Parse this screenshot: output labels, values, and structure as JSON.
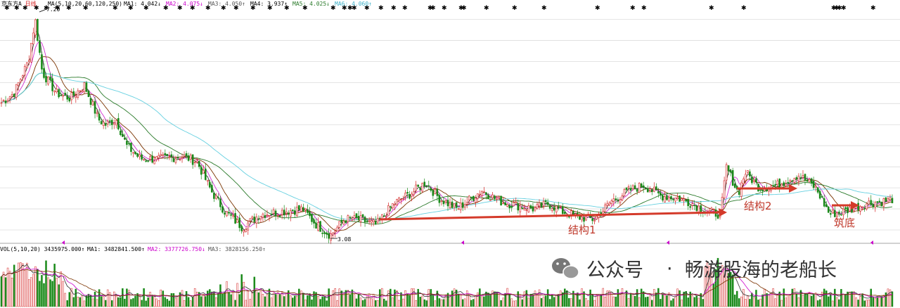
{
  "header": {
    "stock_name": "京东方A",
    "period": "日线",
    "ma_params": "MA(5,10,20,60,120,250)",
    "ma1": "MA1: 4.042↓",
    "ma2": "MA2: 4.075↓",
    "ma3": "MA3: 4.050↑",
    "ma4": "MA4: 3.937↑",
    "ma5": "MA5: 4.025↓",
    "ma6": "MA6: 4.060↑"
  },
  "volume_header": {
    "params": "VOL(5,10,20) 3435975.000↑",
    "ma1": "MA1: 3482841.500↑",
    "ma2": "MA2: 3377726.750↓",
    "ma3": "MA3: 3828156.250↑"
  },
  "price_labels": {
    "high": "7.20",
    "low": "3.08"
  },
  "annotations": {
    "structure1": "结构1",
    "structure2": "结构2",
    "bottom": "筑底"
  },
  "watermark": {
    "dot": "·",
    "text1": "公众号",
    "text2": "畅游股海的老船长"
  },
  "colors": {
    "up": "#d42020",
    "down": "#1a8a1a",
    "arrow": "#d43a2a",
    "ma5": "#333333",
    "ma10": "#d030d0",
    "ma20": "#7a3300",
    "ma60": "#2a7a2a",
    "ma120": "#66d0e0",
    "marker": "#cc00cc"
  },
  "chart_data": {
    "type": "candlestick",
    "panels": [
      "price",
      "volume"
    ],
    "ylim": [
      3.0,
      7.3
    ],
    "grid": true,
    "y_gridlines": [
      3.2,
      3.6,
      4.0,
      4.4,
      4.8,
      5.2,
      5.6,
      6.0,
      6.4,
      6.8,
      7.2
    ],
    "x_points": 420,
    "price_path": [
      [
        0,
        5.6
      ],
      [
        20,
        5.8
      ],
      [
        40,
        6.4
      ],
      [
        50,
        7.2
      ],
      [
        60,
        6.2
      ],
      [
        80,
        5.8
      ],
      [
        100,
        5.7
      ],
      [
        120,
        5.95
      ],
      [
        140,
        5.3
      ],
      [
        150,
        5.2
      ],
      [
        165,
        5.3
      ],
      [
        180,
        4.8
      ],
      [
        200,
        4.55
      ],
      [
        230,
        4.55
      ],
      [
        260,
        4.6
      ],
      [
        280,
        4.5
      ],
      [
        300,
        3.95
      ],
      [
        320,
        3.55
      ],
      [
        345,
        3.25
      ],
      [
        370,
        3.5
      ],
      [
        400,
        3.55
      ],
      [
        430,
        3.6
      ],
      [
        450,
        3.3
      ],
      [
        470,
        3.1
      ],
      [
        490,
        3.4
      ],
      [
        510,
        3.4
      ],
      [
        535,
        3.3
      ],
      [
        560,
        3.7
      ],
      [
        585,
        3.9
      ],
      [
        605,
        4.1
      ],
      [
        625,
        3.8
      ],
      [
        650,
        3.6
      ],
      [
        685,
        3.95
      ],
      [
        710,
        3.75
      ],
      [
        740,
        3.65
      ],
      [
        760,
        3.6
      ],
      [
        780,
        3.7
      ],
      [
        800,
        3.55
      ],
      [
        820,
        3.45
      ],
      [
        845,
        3.4
      ],
      [
        870,
        3.75
      ],
      [
        895,
        3.95
      ],
      [
        915,
        4.05
      ],
      [
        940,
        3.85
      ],
      [
        965,
        3.8
      ],
      [
        985,
        3.7
      ],
      [
        1005,
        3.55
      ],
      [
        1025,
        3.5
      ],
      [
        1033,
        4.4
      ],
      [
        1050,
        3.9
      ],
      [
        1060,
        4.3
      ],
      [
        1080,
        4.0
      ],
      [
        1105,
        4.05
      ],
      [
        1135,
        4.25
      ],
      [
        1160,
        4.0
      ],
      [
        1180,
        3.5
      ],
      [
        1200,
        3.55
      ],
      [
        1230,
        3.7
      ],
      [
        1260,
        3.75
      ],
      [
        1272,
        3.8
      ]
    ],
    "high_point": 7.2,
    "low_point": 3.08,
    "arrows": [
      {
        "label": "结构1",
        "from_price": 3.45,
        "to_price": 3.45
      },
      {
        "label": "结构2",
        "from_price": 3.8,
        "to_price": 3.8
      },
      {
        "label": "筑底",
        "from_price": 3.5,
        "to_price": 3.5
      }
    ]
  }
}
